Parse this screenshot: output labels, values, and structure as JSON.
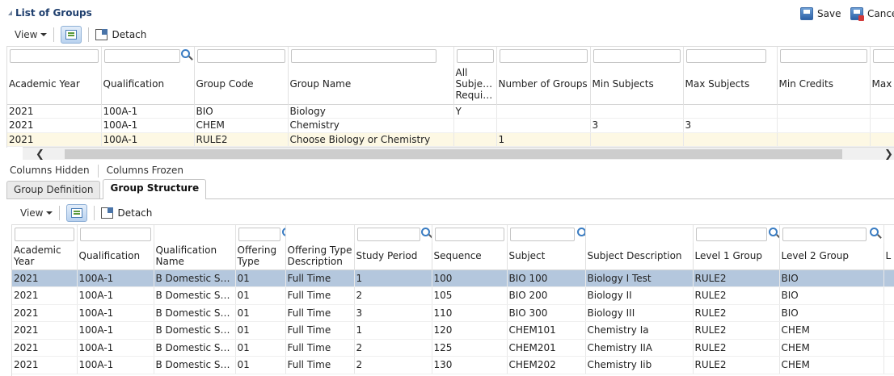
{
  "header": {
    "title": "List of Groups",
    "save_label": "Save",
    "cancel_label": "Cancel"
  },
  "toolbar1": {
    "view_label": "View",
    "detach_label": "Detach"
  },
  "groups_table": {
    "columns": [
      "Academic Year",
      "Qualification",
      "Group Code",
      "Group Name",
      "All Subjects Required",
      "Number of Groups",
      "Min Subjects",
      "Max Subjects",
      "Min Credits",
      "Max C"
    ],
    "rows": [
      [
        "2021",
        "100A-1",
        "BIO",
        "Biology",
        "Y",
        "",
        "",
        "",
        "",
        ""
      ],
      [
        "2021",
        "100A-1",
        "CHEM",
        "Chemistry",
        "",
        "",
        "3",
        "3",
        "",
        ""
      ],
      [
        "2021",
        "100A-1",
        "RULE2",
        "Choose Biology or Chemistry",
        "",
        "1",
        "",
        "",
        "",
        ""
      ]
    ]
  },
  "links": {
    "hidden_label": "Columns Hidden",
    "frozen_label": "Columns Frozen"
  },
  "tabs": [
    {
      "label": "Group Definition"
    },
    {
      "label": "Group Structure"
    }
  ],
  "toolbar2": {
    "view_label": "View",
    "detach_label": "Detach"
  },
  "structure_table": {
    "columns": [
      "Academic Year",
      "Qualification",
      "Qualification Name",
      "Offering Type",
      "Offering Type Description",
      "Study Period",
      "Sequence",
      "Subject",
      "Subject Description",
      "Level 1 Group",
      "Level 2 Group",
      "L"
    ],
    "rows": [
      [
        "2021",
        "100A-1",
        "B Domestic Scie...",
        "01",
        "Full Time",
        "1",
        "100",
        "BIO 100",
        "Biology I Test",
        "RULE2",
        "BIO",
        ""
      ],
      [
        "2021",
        "100A-1",
        "B Domestic Scie...",
        "01",
        "Full Time",
        "2",
        "105",
        "BIO 200",
        "Biology II",
        "RULE2",
        "BIO",
        ""
      ],
      [
        "2021",
        "100A-1",
        "B Domestic Scie...",
        "01",
        "Full Time",
        "3",
        "110",
        "BIO 300",
        "Biology III",
        "RULE2",
        "BIO",
        ""
      ],
      [
        "2021",
        "100A-1",
        "B Domestic Scie...",
        "01",
        "Full Time",
        "1",
        "120",
        "CHEM101",
        "Chemistry Ia",
        "RULE2",
        "CHEM",
        ""
      ],
      [
        "2021",
        "100A-1",
        "B Domestic Scie...",
        "01",
        "Full Time",
        "2",
        "125",
        "CHEM201",
        "Chemistry IIA",
        "RULE2",
        "CHEM",
        ""
      ],
      [
        "2021",
        "100A-1",
        "B Domestic Scie...",
        "01",
        "Full Time",
        "2",
        "130",
        "CHEM202",
        "Chemistry Iib",
        "RULE2",
        "CHEM",
        ""
      ]
    ]
  }
}
